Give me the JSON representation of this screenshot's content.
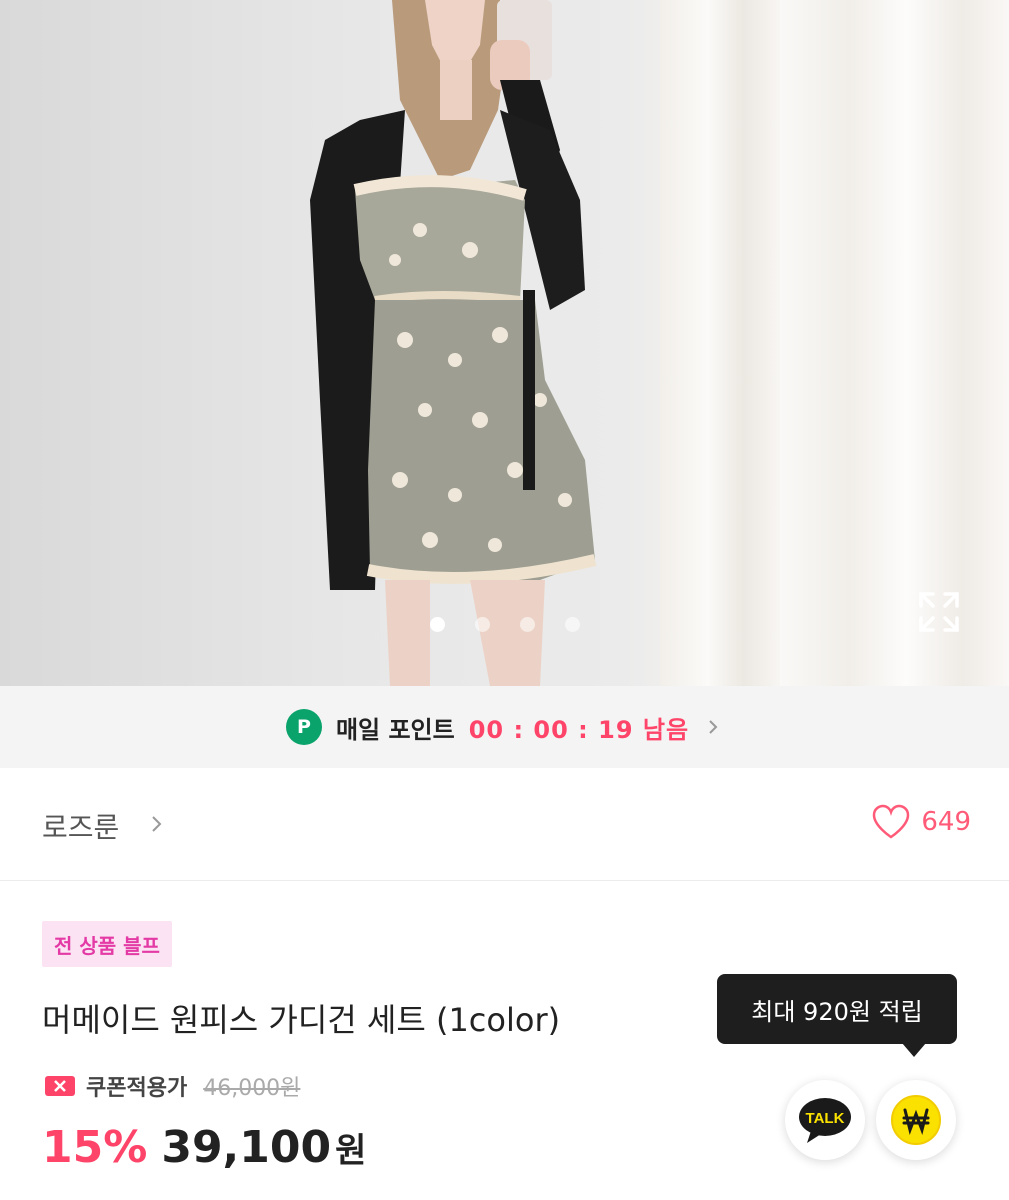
{
  "gallery": {
    "total_images": 4,
    "active_index": 0
  },
  "points_banner": {
    "label": "매일 포인트",
    "timer": "00 : 00 : 19",
    "suffix": "남음"
  },
  "brand": {
    "name": "로즈룬",
    "likes": "649"
  },
  "product": {
    "badge": "전 상품 블프",
    "title": "머메이드 원피스 가디건 세트 (1color)",
    "coupon_label": "쿠폰적용가",
    "original_price": "46,000원",
    "discount": "15%",
    "price": "39,100",
    "currency": "원"
  },
  "reward": {
    "tooltip": "최대 920원 적립"
  },
  "talk_button": {
    "label": "TALK"
  },
  "colors": {
    "accent": "#ff4469",
    "points_green": "#0aa36c",
    "badge_bg": "#fbe3f3",
    "badge_text": "#e33aa5",
    "kakao_yellow": "#fae100"
  }
}
